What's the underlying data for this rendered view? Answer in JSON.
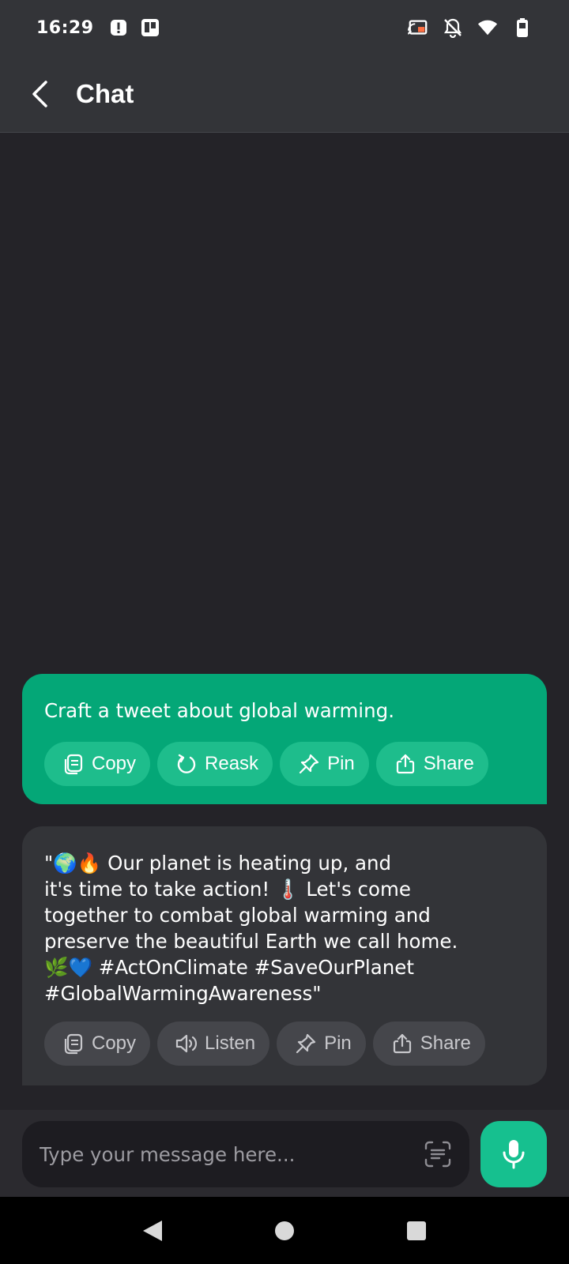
{
  "status_bar": {
    "time": "16:29",
    "left_icons": [
      "alert-icon",
      "trello-icon"
    ],
    "right_icons": [
      "cast-icon",
      "notifications-off-icon",
      "wifi-icon",
      "battery-icon"
    ]
  },
  "app_bar": {
    "title": "Chat",
    "back_icon": "back-arrow-icon"
  },
  "messages": [
    {
      "role": "user",
      "text": "Craft a tweet about global warming.",
      "actions": [
        {
          "label": "Copy",
          "icon": "copy-icon"
        },
        {
          "label": "Reask",
          "icon": "refresh-icon"
        },
        {
          "label": "Pin",
          "icon": "pin-icon"
        },
        {
          "label": "Share",
          "icon": "share-icon"
        }
      ]
    },
    {
      "role": "assistant",
      "text": "\"🌍🔥 Our planet is heating up, and\nit's time to take action! 🌡️ Let's come\ntogether to combat global warming and\npreserve the beautiful Earth we call home.\n🌿💙 #ActOnClimate #SaveOurPlanet\n#GlobalWarmingAwareness\"",
      "actions": [
        {
          "label": "Copy",
          "icon": "copy-icon"
        },
        {
          "label": "Listen",
          "icon": "speaker-icon"
        },
        {
          "label": "Pin",
          "icon": "pin-icon"
        },
        {
          "label": "Share",
          "icon": "share-icon"
        }
      ]
    }
  ],
  "composer": {
    "placeholder": "Type your message here...",
    "value": "",
    "scan_icon": "scan-text-icon",
    "mic_icon": "microphone-icon"
  },
  "nav_bar": {
    "buttons": [
      "nav-back-icon",
      "nav-home-icon",
      "nav-recents-icon"
    ]
  },
  "colors": {
    "accent": "#04a777",
    "mic": "#16c08f",
    "background": "#242328",
    "surface": "#333438"
  }
}
